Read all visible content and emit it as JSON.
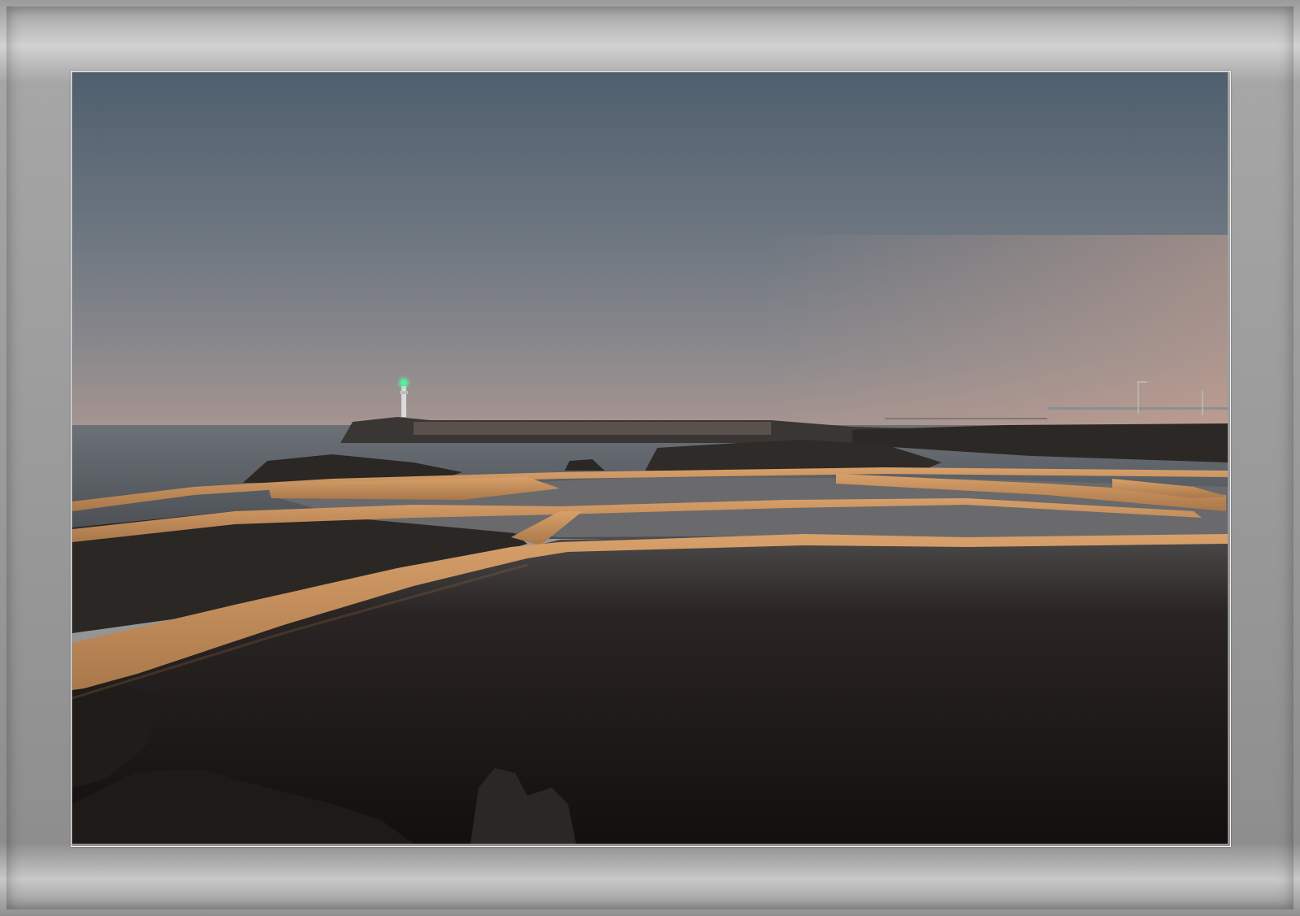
{
  "image": {
    "subject": "dusk-seascape",
    "colors": {
      "sky_top": "#4f5f6e",
      "sky_mid": "#7a818a",
      "sky_horizon": "#b29a90",
      "sea": "#676d73",
      "pool": "#1a1716",
      "salt_wall": "#c8925c",
      "rock": "#262422",
      "beacon": "#39ff9a",
      "frame": "#a0a0a0"
    }
  }
}
